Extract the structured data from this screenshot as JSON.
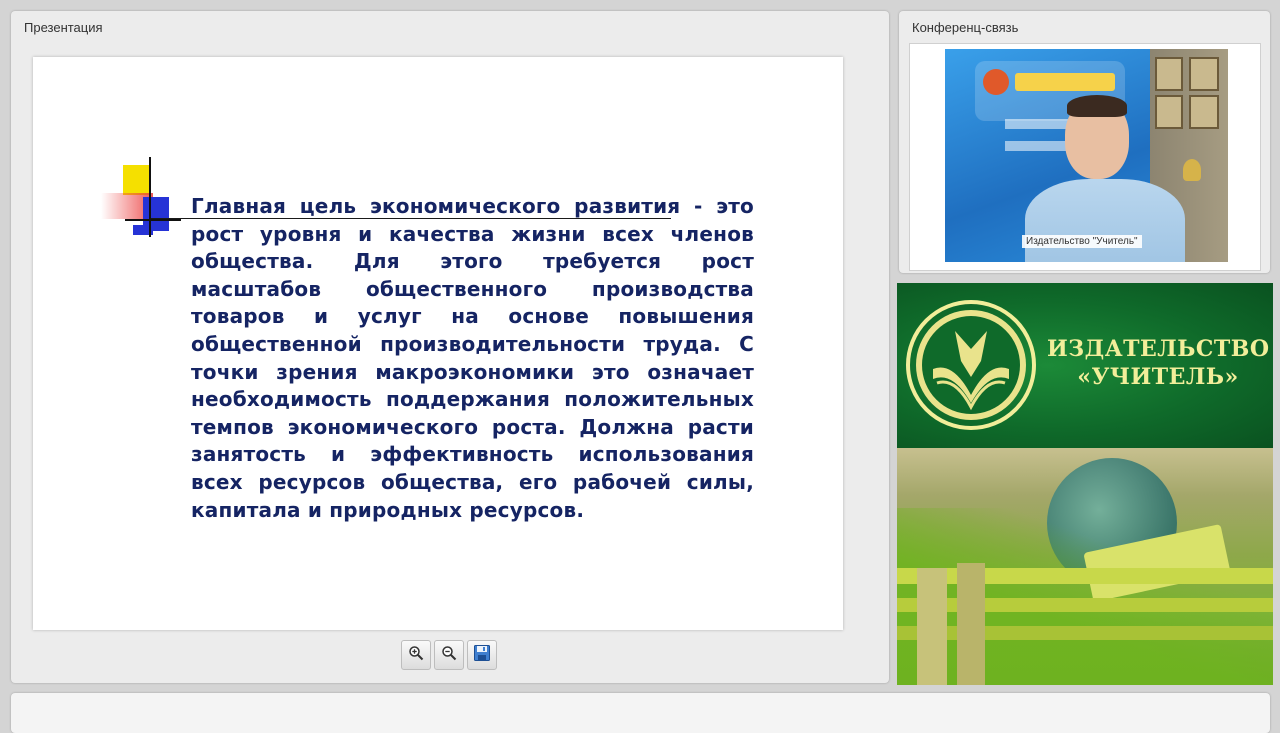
{
  "presentation": {
    "title": "Презентация",
    "slide_text": "Главная цель экономического развития - это рост уровня и качества жизни всех членов общества. Для этого требуется рост масштабов общественного производства товаров и услуг на основе повышения общественной производительности труда. С точки зрения макроэкономики это означает необходимость поддержания положительных темпов экономического роста. Должна расти занятость и эффективность использования всех ресурсов общества, его рабочей силы, капитала и природных ресурсов."
  },
  "toolbar": {
    "icons": [
      "zoom-in-icon",
      "zoom-out-icon",
      "save-icon"
    ]
  },
  "conference": {
    "title": "Конференц-связь",
    "video_label": "Издательство \"Учитель\""
  },
  "ad": {
    "line1": "ИЗДАТЕЛЬСТВО",
    "line2": "«УЧИТЕЛЬ»"
  },
  "colors": {
    "slide_text": "#152463",
    "ad_green": "#0f6a2a",
    "ad_text": "#f2ee9a"
  }
}
